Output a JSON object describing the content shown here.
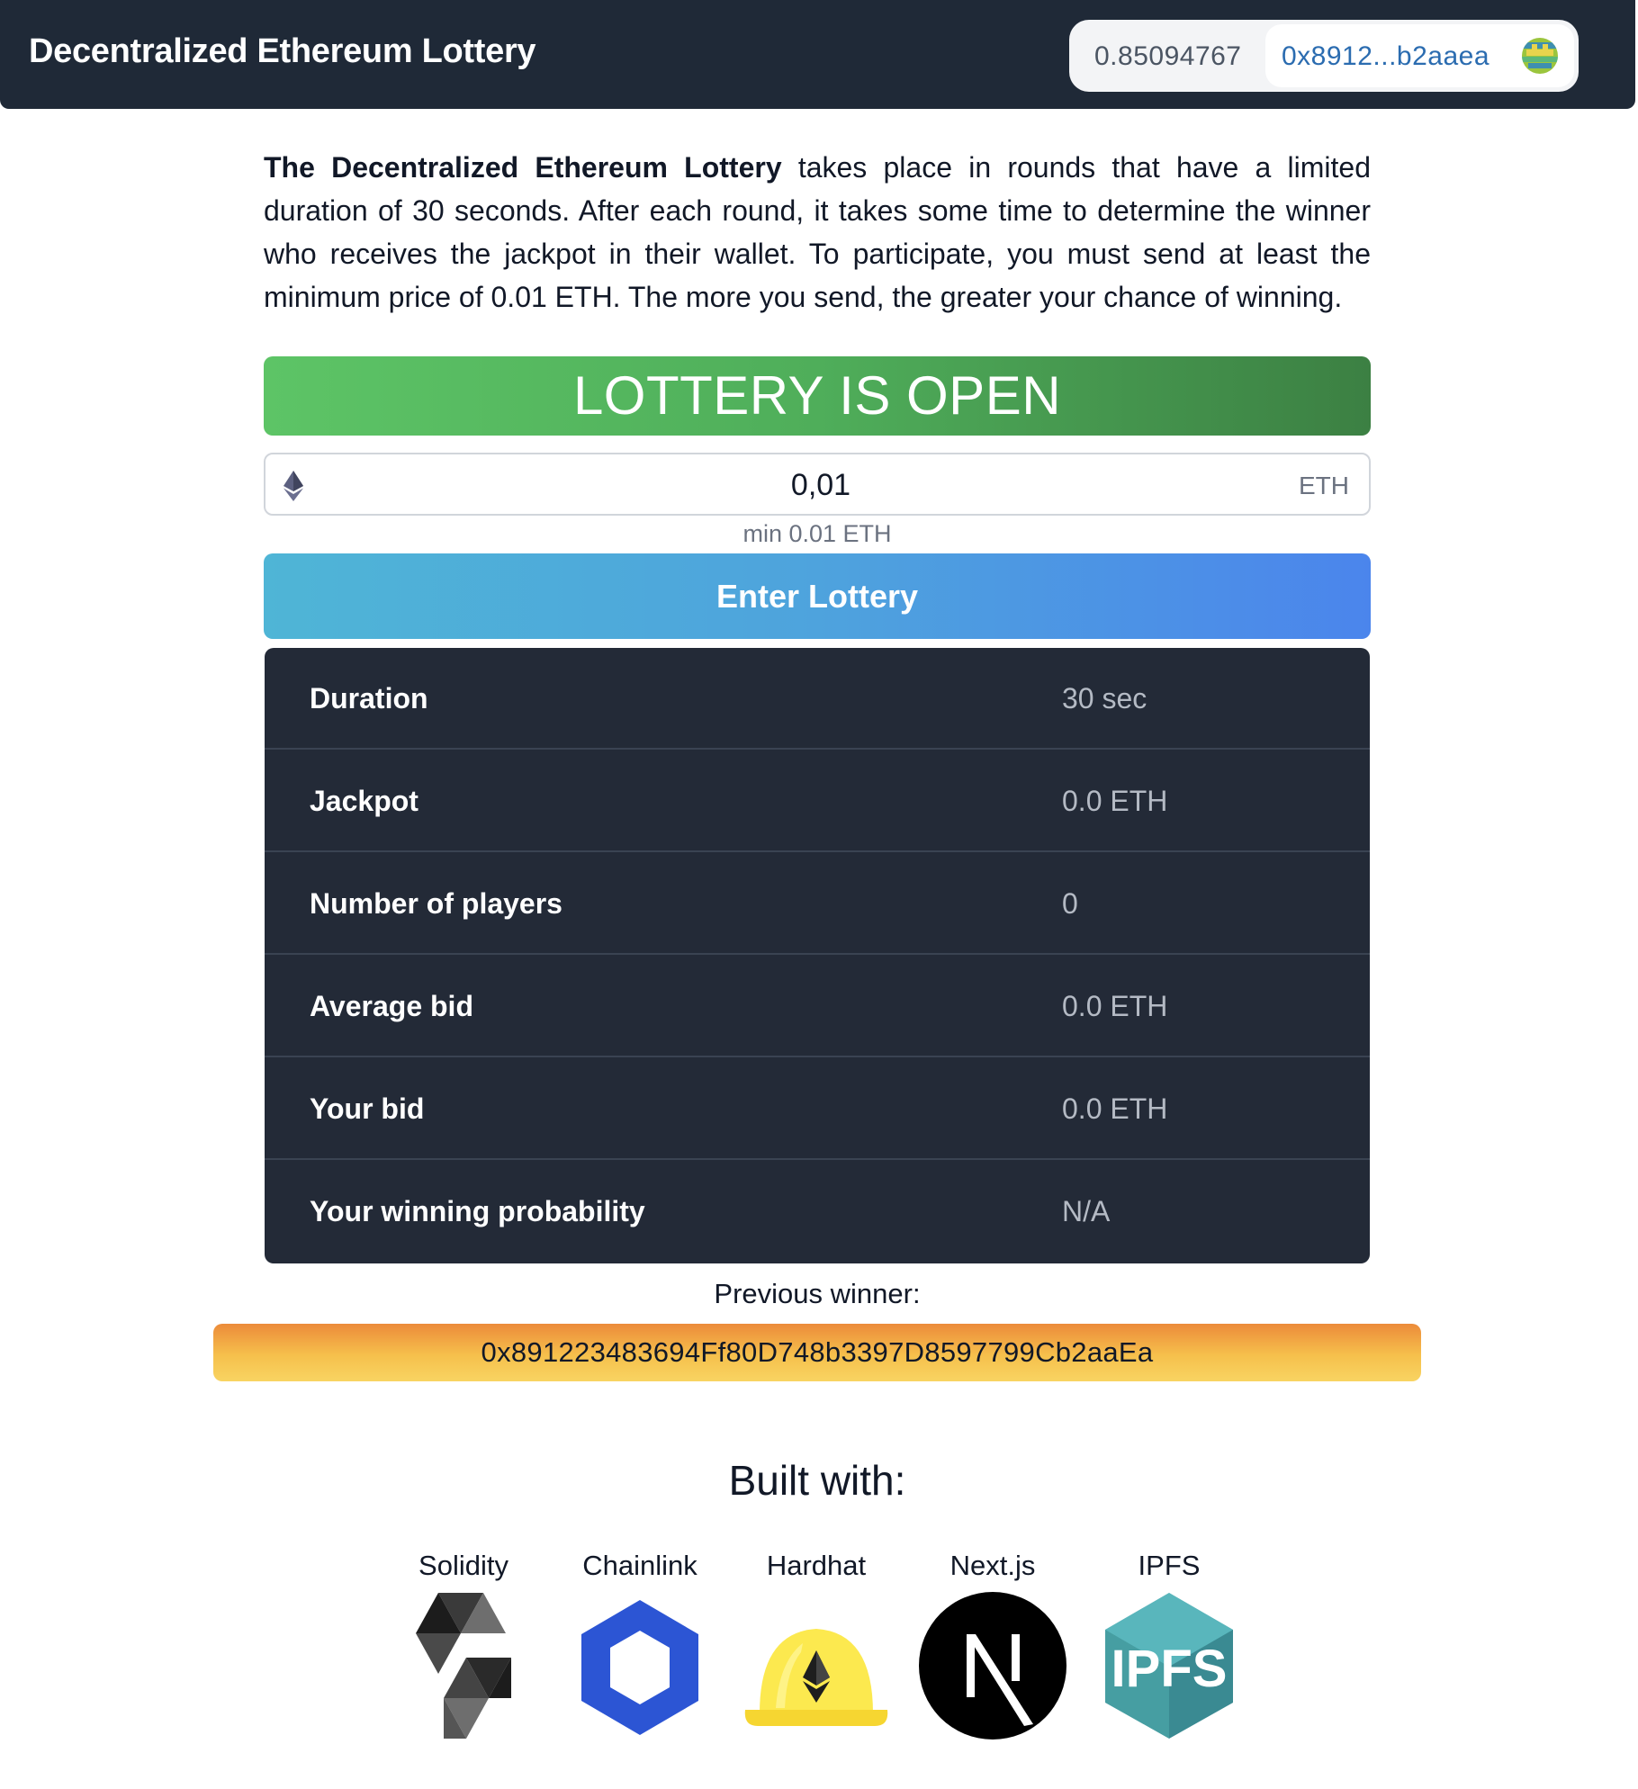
{
  "navbar": {
    "title": "Decentralized Ethereum Lottery",
    "balance": "0.85094767",
    "address": "0x8912...b2aaea"
  },
  "intro": {
    "bold": "The Decentralized Ethereum Lottery",
    "rest": " takes place in rounds that have a limited duration of 30 seconds. After each round, it takes some time to determine the winner who receives the jackpot in their wallet. To participate, you must send at least the minimum price of 0.01 ETH. The more you send, the greater your chance of winning."
  },
  "status": {
    "label": "LOTTERY IS OPEN",
    "color": "#4fae5a"
  },
  "bid": {
    "value": "0,01",
    "unit": "ETH",
    "min_note": "min 0.01 ETH",
    "icon": "ethereum-icon"
  },
  "enter_button": "Enter Lottery",
  "stats": [
    {
      "label": "Duration",
      "value": "30 sec"
    },
    {
      "label": "Jackpot",
      "value": "0.0 ETH"
    },
    {
      "label": "Number of players",
      "value": "0"
    },
    {
      "label": "Average bid",
      "value": "0.0 ETH"
    },
    {
      "label": "Your bid",
      "value": "0.0 ETH"
    },
    {
      "label": "Your winning probability",
      "value": "N/A"
    }
  ],
  "previous_winner": {
    "label": "Previous winner:",
    "address": "0x891223483694Ff80D748b3397D8597799Cb2aaEa"
  },
  "built_with": {
    "title": "Built with:",
    "items": [
      {
        "name": "Solidity",
        "icon": "solidity-logo"
      },
      {
        "name": "Chainlink",
        "icon": "chainlink-logo"
      },
      {
        "name": "Hardhat",
        "icon": "hardhat-logo"
      },
      {
        "name": "Next.js",
        "icon": "nextjs-logo"
      },
      {
        "name": "IPFS",
        "icon": "ipfs-logo"
      }
    ]
  },
  "colors": {
    "navbar": "#1f2937",
    "address": "#2b6cb0",
    "stats_bg": "#232a37",
    "enter_start": "#4fb5d6",
    "enter_end": "#4b85ec",
    "winner_bar": "#f6c04c"
  }
}
